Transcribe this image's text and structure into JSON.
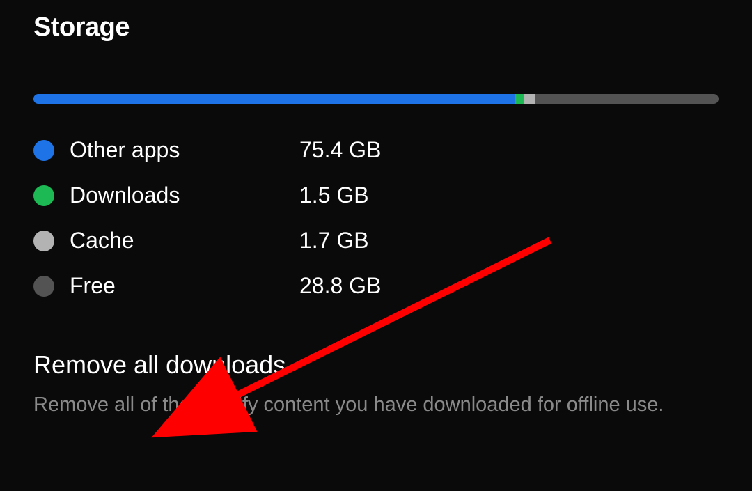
{
  "storage": {
    "heading": "Storage",
    "bar_segments": [
      {
        "key": "other_apps",
        "color": "#1e74e6",
        "value_gb": 75.4
      },
      {
        "key": "downloads",
        "color": "#1db954",
        "value_gb": 1.5
      },
      {
        "key": "cache",
        "color": "#b3b3b3",
        "value_gb": 1.7
      },
      {
        "key": "free",
        "color": "#535353",
        "value_gb": 28.8
      }
    ],
    "legend": [
      {
        "label": "Other apps",
        "value": "75.4 GB",
        "color": "#1e74e6"
      },
      {
        "label": "Downloads",
        "value": "1.5 GB",
        "color": "#1db954"
      },
      {
        "label": "Cache",
        "value": "1.7 GB",
        "color": "#b3b3b3"
      },
      {
        "label": "Free",
        "value": "28.8 GB",
        "color": "#535353"
      }
    ]
  },
  "action": {
    "title": "Remove all downloads",
    "description": "Remove all of the Spotify content you have downloaded for offline use."
  },
  "annotation": {
    "arrow_color": "#ff0000"
  }
}
